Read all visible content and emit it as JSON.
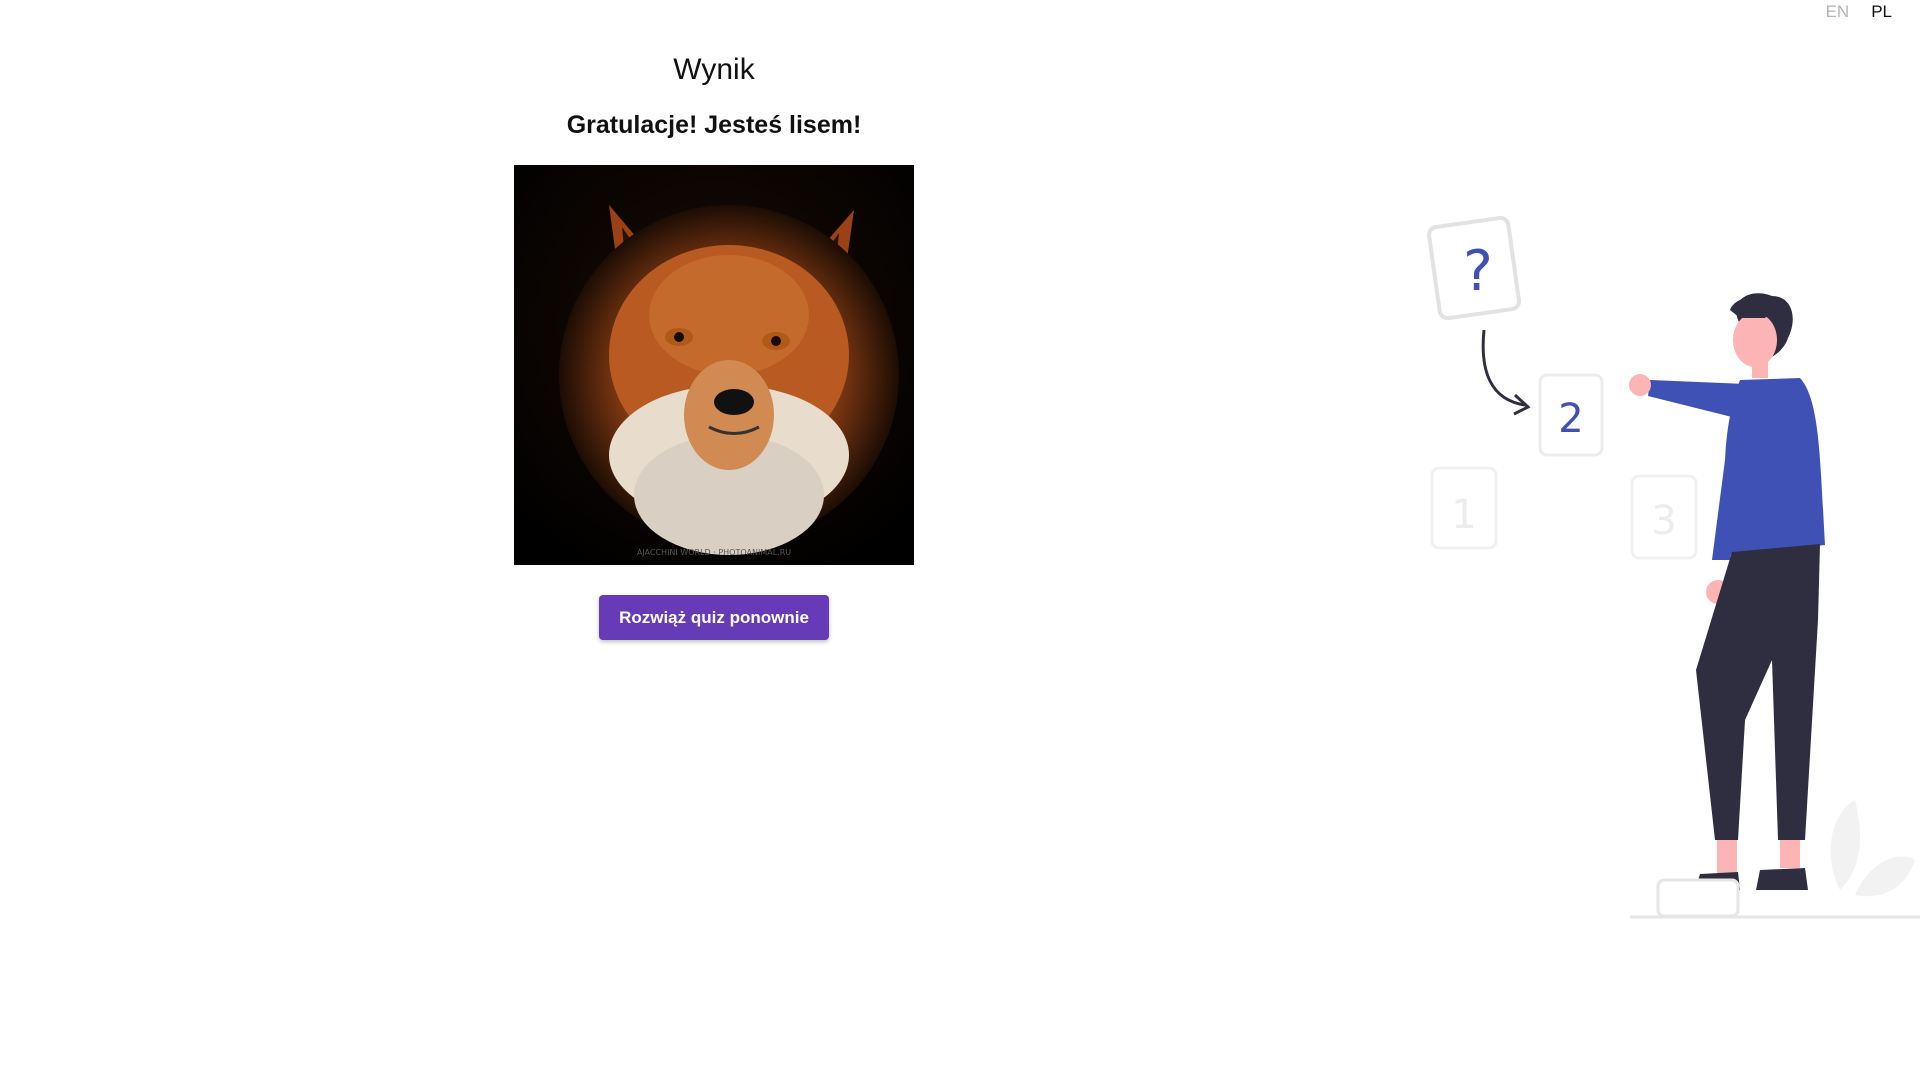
{
  "language_switch": {
    "options": [
      "EN",
      "PL"
    ],
    "active": "PL"
  },
  "result": {
    "title": "Wynik",
    "message": "Gratulacje! Jesteś lisem!",
    "image_icon": "fox-photo",
    "retry_button_label": "Rozwiąż quiz ponownie"
  },
  "illustration": {
    "cards": [
      "?",
      "2",
      "1",
      "3"
    ],
    "icon": "person-with-cards-illustration"
  },
  "colors": {
    "accent": "#673ab7",
    "illustration_shirt": "#3f51b5",
    "illustration_pants": "#2f2e41"
  }
}
